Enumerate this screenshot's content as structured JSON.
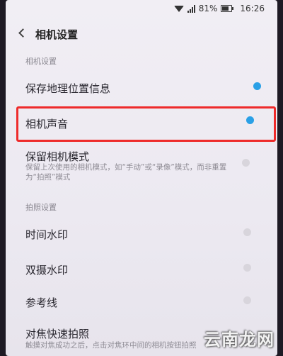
{
  "status_bar": {
    "battery": "81%",
    "time": "16:26"
  },
  "header": {
    "title": "相机设置"
  },
  "sections": {
    "camera_settings": "相机设置",
    "shooting_settings": "拍照设置"
  },
  "settings": {
    "location_info": {
      "label": "保存地理位置信息",
      "on": true
    },
    "camera_sound": {
      "label": "相机声音",
      "on": true
    },
    "keep_mode": {
      "label": "保留相机模式",
      "description": "保留上次使用的相机模式，如“手动”或“录像”模式，而非重置为“拍照”模式",
      "on": false
    },
    "time_watermark": {
      "label": "时间水印",
      "on": false
    },
    "dual_watermark": {
      "label": "双摄水印",
      "on": false
    },
    "grid": {
      "label": "参考线",
      "on": false
    },
    "focus_shoot": {
      "label": "对焦快速拍照",
      "description": "触摸对焦成功之后，点击对焦环中间的相机按钮拍照"
    }
  },
  "colors": {
    "toggle_on": "#2aa0e6",
    "highlight": "#ee2b2b"
  },
  "watermark": "云南龙网"
}
